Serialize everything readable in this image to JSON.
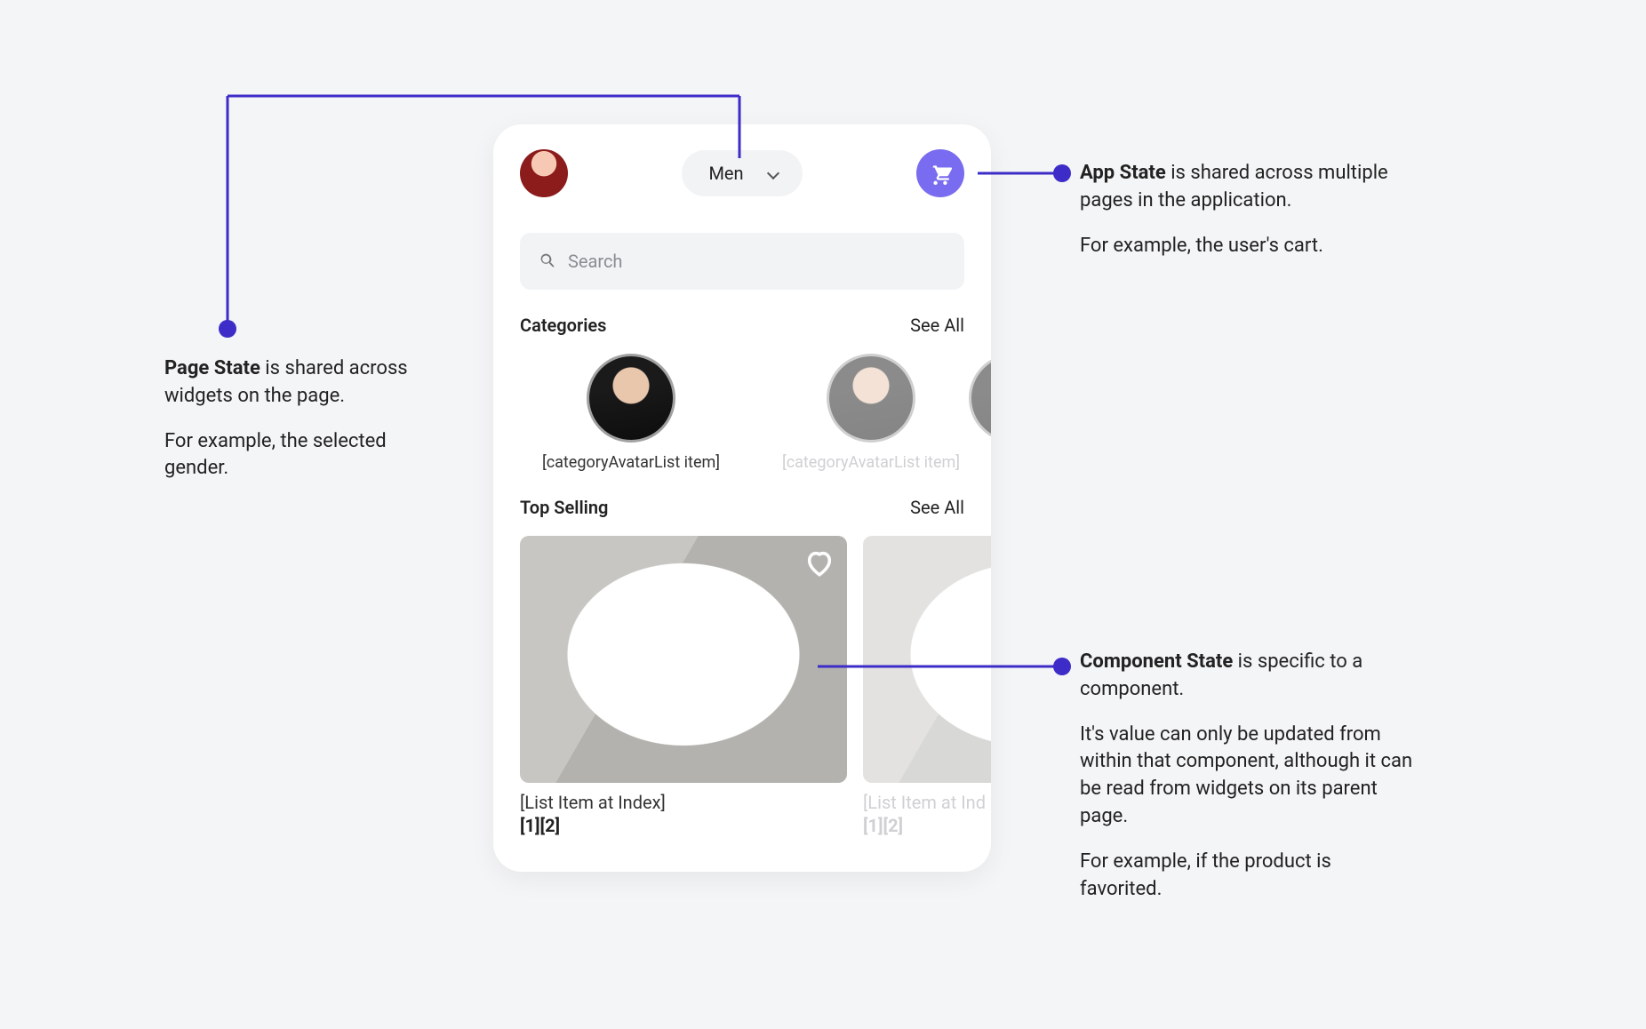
{
  "phone": {
    "gender_selected": "Men",
    "search_placeholder": "Search",
    "sections": {
      "categories_title": "Categories",
      "categories_see_all": "See All",
      "top_selling_title": "Top Selling",
      "top_selling_see_all": "See All"
    },
    "category_items": [
      {
        "label": "[categoryAvatarList item]"
      },
      {
        "label": "[categoryAvatarList item]"
      }
    ],
    "product_items": [
      {
        "title": "[List Item at Index]",
        "sub": "[1][2]"
      },
      {
        "title": "[List Item at Ind",
        "sub": "[1][2]"
      }
    ]
  },
  "annotations": {
    "page_state": {
      "heading_bold": "Page State",
      "heading_rest": " is shared across widgets on the page.",
      "example": "For example,  the selected gender."
    },
    "app_state": {
      "heading_bold": "App State",
      "heading_rest": " is shared across multiple pages in the application.",
      "example": "For example, the user's cart."
    },
    "component_state": {
      "heading_bold": "Component State",
      "heading_rest": " is specific to a component.",
      "detail": "It's value can only be updated from within that component, although it can be read from widgets on its parent page.",
      "example": "For example, if the product is favorited."
    }
  },
  "colors": {
    "accent": "#3d2cc7",
    "cart": "#7a6cf0"
  }
}
